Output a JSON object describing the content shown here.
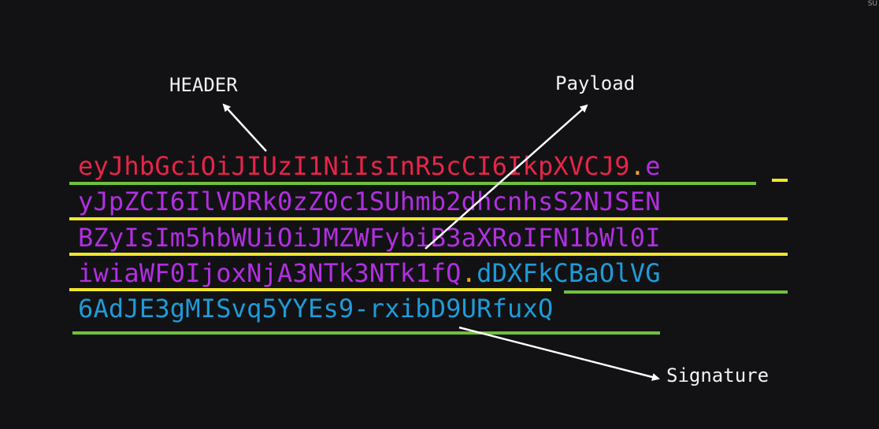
{
  "labels": {
    "header": "HEADER",
    "payload": "Payload",
    "signature": "Signature"
  },
  "watermark": "SU",
  "jwt": {
    "line1": {
      "header": "eyJhbGciOiJIUzI1NiIsInR5cCI6IkpXVCJ9",
      "dot": ".",
      "payload": "e"
    },
    "line2": {
      "payload": "yJpZCI6IlVDRk0zZ0c1SUhmb2dhcnhsS2NJSEN"
    },
    "line3": {
      "payload": "BZyIsIm5hbWUiOiJMZWFybiB3aXRoIFN1bWl0I"
    },
    "line4": {
      "payload": "iwiaWF0IjoxNjA3NTk3NTk1fQ",
      "dot": ".",
      "signature": "dDXFkCBaOlVG"
    },
    "line5": {
      "signature": "6AdJE3gMISvq5YYEs9-rxibD9URfuxQ"
    }
  },
  "colors": {
    "background": "#121214",
    "header": "#e8244a",
    "payload": "#b12fe0",
    "signature": "#1f9bd8",
    "separator_dot": "#f0a319",
    "underline_green": "#6fc13c",
    "underline_yellow": "#f2e52a",
    "arrow": "#ffffff"
  }
}
